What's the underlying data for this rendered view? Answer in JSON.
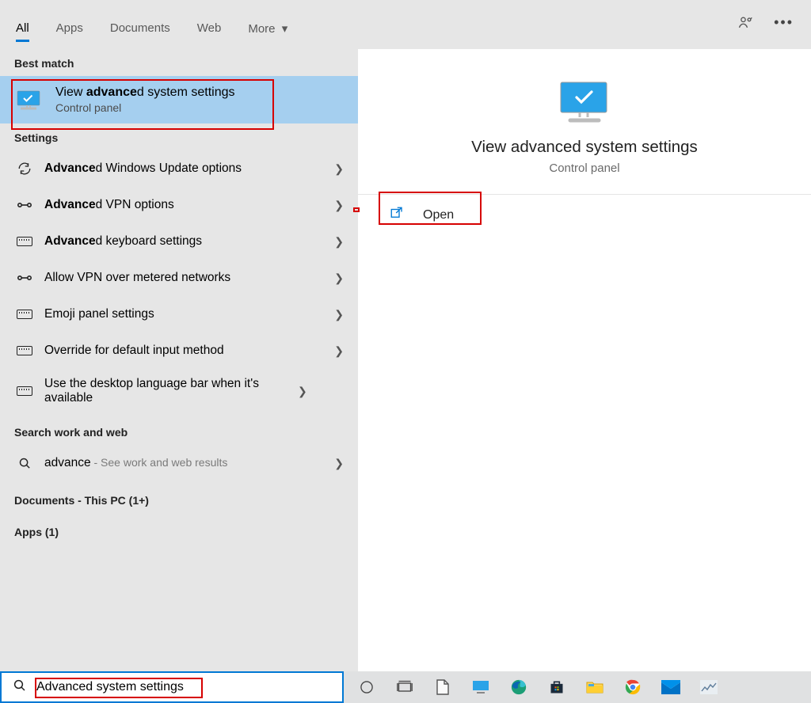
{
  "tabs": {
    "items": [
      "All",
      "Apps",
      "Documents",
      "Web",
      "More"
    ],
    "active": "All"
  },
  "sections": {
    "best_match": "Best match",
    "settings": "Settings",
    "search_web": "Search work and web",
    "documents": "Documents - This PC (1+)",
    "apps": "Apps (1)"
  },
  "best_match": {
    "title_pre": "View ",
    "title_bold": "advance",
    "title_post": "d system settings",
    "subtitle": "Control panel"
  },
  "settings": [
    {
      "icon": "refresh",
      "bold": "Advance",
      "rest": "d Windows Update options"
    },
    {
      "icon": "vpn",
      "bold": "Advance",
      "rest": "d VPN options"
    },
    {
      "icon": "keyboard",
      "bold": "Advance",
      "rest": "d keyboard settings"
    },
    {
      "icon": "vpn",
      "bold": "",
      "rest": "Allow VPN over metered networks"
    },
    {
      "icon": "keyboard",
      "bold": "",
      "rest": "Emoji panel settings"
    },
    {
      "icon": "keyboard",
      "bold": "",
      "rest": "Override for default input method"
    },
    {
      "icon": "keyboard",
      "bold": "",
      "rest": "Use the desktop language bar when it's available"
    }
  ],
  "web_search": {
    "term": "advance",
    "hint": " - See work and web results"
  },
  "detail": {
    "title": "View advanced system settings",
    "subtitle": "Control panel",
    "open": "Open"
  },
  "search_input": "Advanced system settings"
}
